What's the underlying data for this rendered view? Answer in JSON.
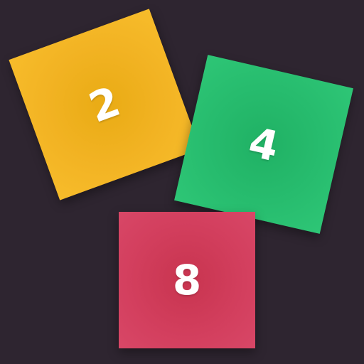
{
  "tiles": [
    {
      "value": "2",
      "color": "#f2b323"
    },
    {
      "value": "4",
      "color": "#27bc6e"
    },
    {
      "value": "8",
      "color": "#d33f5e"
    }
  ],
  "background_color": "#2e2530"
}
